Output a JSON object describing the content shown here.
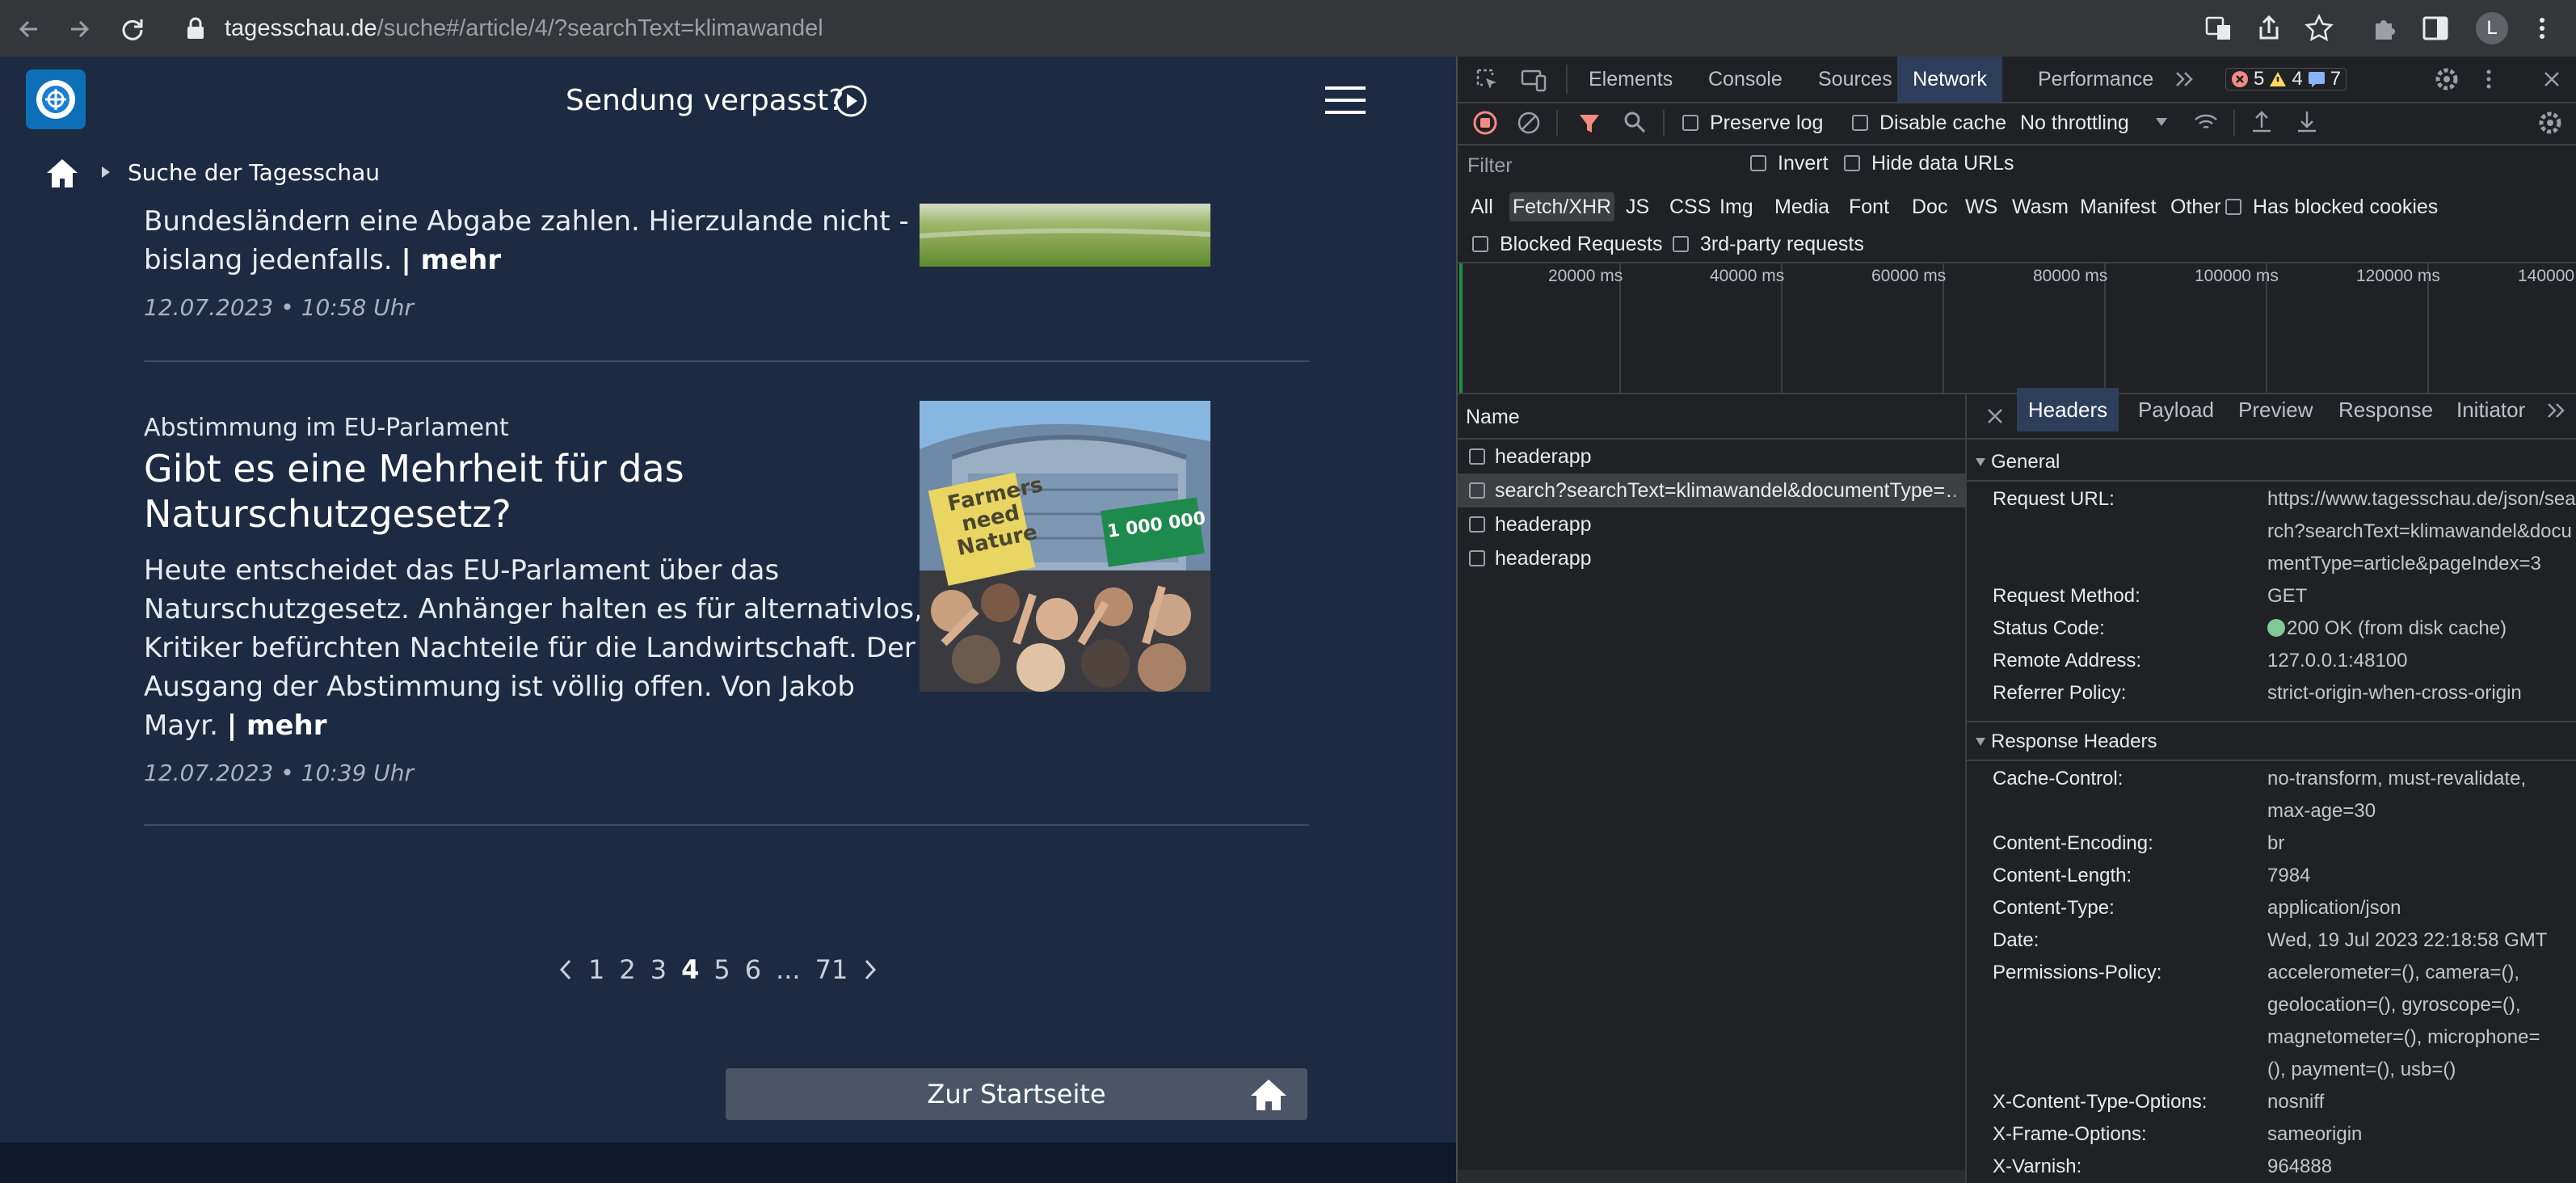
{
  "browser": {
    "url_host": "tagesschau.de",
    "url_path": "/suche#/article/4/?searchText=klimawandel",
    "profile_initial": "L"
  },
  "site": {
    "sendung_label": "Sendung verpasst?",
    "breadcrumb": "Suche der Tagesschau",
    "article1": {
      "text_line1": "Bundesländern eine Abgabe zahlen. Hierzulande nicht -",
      "text_line2": "bislang jedenfalls.",
      "more": "| mehr",
      "date": "12.07.2023 • 10:58 Uhr"
    },
    "article2": {
      "kicker": "Abstimmung im EU-Parlament",
      "headline_line1": "Gibt es eine Mehrheit für das",
      "headline_line2": "Naturschutzgesetz?",
      "text_line1": "Heute entscheidet das EU-Parlament über das",
      "text_line2": "Naturschutzgesetz. Anhänger halten es für alternativlos,",
      "text_line3": "Kritiker befürchten Nachteile für die Landwirtschaft. Der",
      "text_line4": "Ausgang der Abstimmung ist völlig offen.  Von Jakob",
      "text_line5": "Mayr.",
      "more": "| mehr",
      "date": "12.07.2023 • 10:39 Uhr",
      "sign_left": "Farmers need Nature",
      "sign_right": "1 000 000"
    },
    "pagination": {
      "pages": [
        "1",
        "2",
        "3",
        "4",
        "5",
        "6",
        "...",
        "71"
      ],
      "current": "4"
    },
    "startseite_label": "Zur Startseite"
  },
  "devtools": {
    "tabs": [
      "Elements",
      "Console",
      "Sources",
      "Network",
      "Performance"
    ],
    "errors": "5",
    "warnings": "4",
    "messages": "7",
    "toolbar": {
      "preserve_log": "Preserve log",
      "disable_cache": "Disable cache",
      "throttling": "No throttling"
    },
    "filter_placeholder": "Filter",
    "invert": "Invert",
    "hide_data_urls": "Hide data URLs",
    "filter_types": [
      "All",
      "Fetch/XHR",
      "JS",
      "CSS",
      "Img",
      "Media",
      "Font",
      "Doc",
      "WS",
      "Wasm",
      "Manifest",
      "Other"
    ],
    "has_blocked_cookies": "Has blocked cookies",
    "blocked_requests": "Blocked Requests",
    "third_party": "3rd-party requests",
    "timeline_labels": [
      "20000 ms",
      "40000 ms",
      "60000 ms",
      "80000 ms",
      "100000 ms",
      "120000 ms",
      "140000"
    ],
    "name_header": "Name",
    "requests": [
      "headerapp",
      "search?searchText=klimawandel&documentType=…",
      "headerapp",
      "headerapp"
    ],
    "detail_tabs": [
      "Headers",
      "Payload",
      "Preview",
      "Response",
      "Initiator"
    ],
    "general_title": "General",
    "general": [
      {
        "k": "Request URL:",
        "v1": "https://www.tagesschau.de/json/sea",
        "v2": "rch?searchText=klimawandel&docu",
        "v3": "mentType=article&pageIndex=3"
      },
      {
        "k": "Request Method:",
        "v1": "GET"
      },
      {
        "k": "Status Code:",
        "v1": "200 OK (from disk cache)"
      },
      {
        "k": "Remote Address:",
        "v1": "127.0.0.1:48100"
      },
      {
        "k": "Referrer Policy:",
        "v1": "strict-origin-when-cross-origin"
      }
    ],
    "response_title": "Response Headers",
    "response": [
      {
        "k": "Cache-Control:",
        "v1": "no-transform, must-revalidate,",
        "v2": "max-age=30"
      },
      {
        "k": "Content-Encoding:",
        "v1": "br"
      },
      {
        "k": "Content-Length:",
        "v1": "7984"
      },
      {
        "k": "Content-Type:",
        "v1": "application/json"
      },
      {
        "k": "Date:",
        "v1": "Wed, 19 Jul 2023 22:18:58 GMT"
      },
      {
        "k": "Permissions-Policy:",
        "v1": "accelerometer=(), camera=(),",
        "v2": "geolocation=(), gyroscope=(),",
        "v3": "magnetometer=(), microphone=",
        "v4": "(), payment=(), usb=()"
      },
      {
        "k": "X-Content-Type-Options:",
        "v1": "nosniff"
      },
      {
        "k": "X-Frame-Options:",
        "v1": "sameorigin"
      },
      {
        "k": "X-Varnish:",
        "v1": "964888"
      }
    ]
  }
}
